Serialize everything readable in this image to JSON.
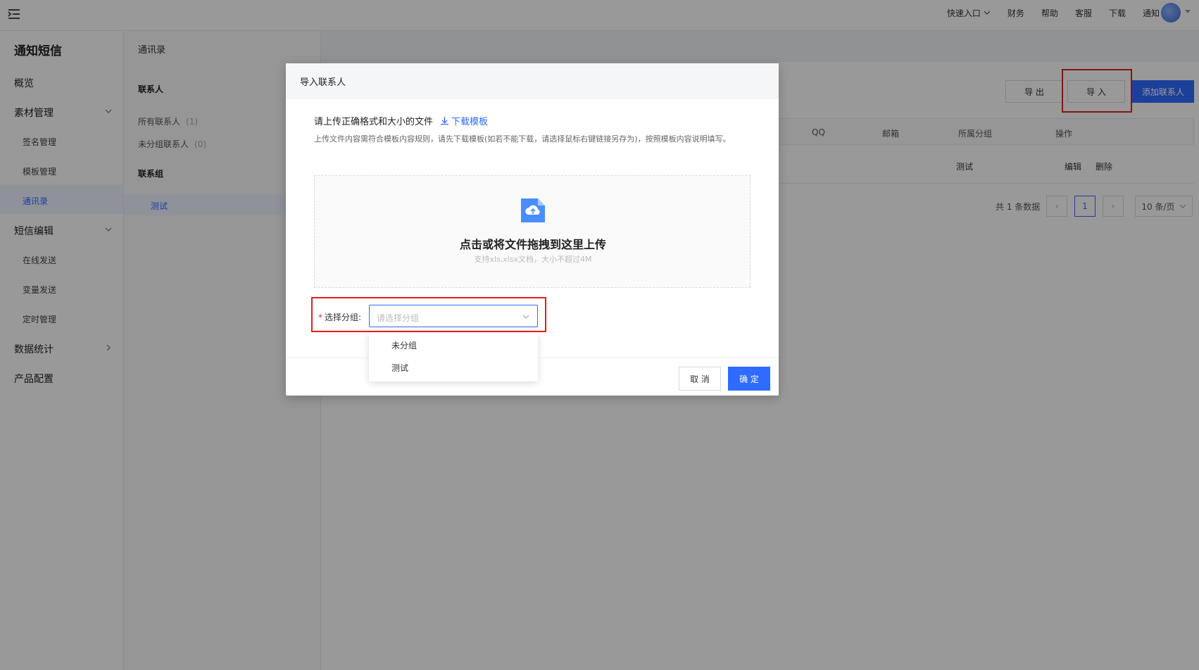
{
  "topbar": {
    "quick_entry": "快速入口",
    "links": [
      "财务",
      "帮助",
      "客服",
      "下载",
      "通知"
    ]
  },
  "sidebar": {
    "title": "通知短信",
    "overview": "概览",
    "material": "素材管理",
    "material_items": [
      "签名管理",
      "模板管理",
      "通讯录"
    ],
    "sms_edit": "短信编辑",
    "sms_items": [
      "在线发送",
      "变量发送",
      "定时管理"
    ],
    "stats": "数据统计",
    "product": "产品配置"
  },
  "contacts_panel": {
    "breadcrumb": "通讯录",
    "contacts_heading": "联系人",
    "all_contacts": "所有联系人",
    "all_count": "(1)",
    "ungrouped_contacts": "未分组联系人",
    "ungrouped_count": "(0)",
    "groups_heading": "联系组",
    "group_active": "测试"
  },
  "main": {
    "export_label": "导 出",
    "import_label": "导 入",
    "add_label": "添加联系人",
    "columns": [
      "QQ",
      "邮箱",
      "所属分组",
      "操作"
    ],
    "row": {
      "group": "测试",
      "edit": "编辑",
      "delete": "删除"
    },
    "pager": {
      "total": "共 1 条数据",
      "page": "1",
      "size": "10 条/页"
    }
  },
  "modal": {
    "title": "导入联系人",
    "tip": "请上传正确格式和大小的文件",
    "download_template": "下载模板",
    "description": "上传文件内容需符合模板内容规则，请先下载模板(如若不能下载，请选择鼠标右键链接另存为)，按照模板内容说明填写。",
    "upload_text": "点击或将文件拖拽到这里上传",
    "upload_hint": "支持xls,xlsx文档，大小不超过4M",
    "group_label": "选择分组:",
    "group_placeholder": "请选择分组",
    "group_options": [
      "未分组",
      "测试"
    ],
    "cancel_label": "取 消",
    "confirm_label": "确 定"
  },
  "colors": {
    "accent": "#2f6bff",
    "highlight": "#e0201b"
  }
}
